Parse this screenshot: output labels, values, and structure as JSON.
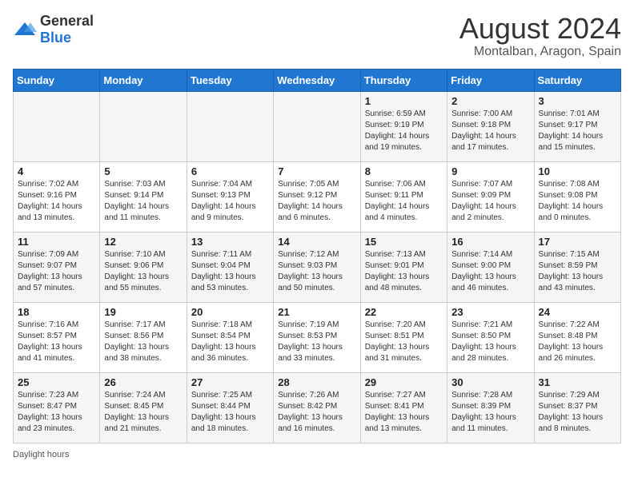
{
  "logo": {
    "text_general": "General",
    "text_blue": "Blue"
  },
  "title": "August 2024",
  "subtitle": "Montalban, Aragon, Spain",
  "days_of_week": [
    "Sunday",
    "Monday",
    "Tuesday",
    "Wednesday",
    "Thursday",
    "Friday",
    "Saturday"
  ],
  "weeks": [
    [
      {
        "day": "",
        "info": ""
      },
      {
        "day": "",
        "info": ""
      },
      {
        "day": "",
        "info": ""
      },
      {
        "day": "",
        "info": ""
      },
      {
        "day": "1",
        "info": "Sunrise: 6:59 AM\nSunset: 9:19 PM\nDaylight: 14 hours\nand 19 minutes."
      },
      {
        "day": "2",
        "info": "Sunrise: 7:00 AM\nSunset: 9:18 PM\nDaylight: 14 hours\nand 17 minutes."
      },
      {
        "day": "3",
        "info": "Sunrise: 7:01 AM\nSunset: 9:17 PM\nDaylight: 14 hours\nand 15 minutes."
      }
    ],
    [
      {
        "day": "4",
        "info": "Sunrise: 7:02 AM\nSunset: 9:16 PM\nDaylight: 14 hours\nand 13 minutes."
      },
      {
        "day": "5",
        "info": "Sunrise: 7:03 AM\nSunset: 9:14 PM\nDaylight: 14 hours\nand 11 minutes."
      },
      {
        "day": "6",
        "info": "Sunrise: 7:04 AM\nSunset: 9:13 PM\nDaylight: 14 hours\nand 9 minutes."
      },
      {
        "day": "7",
        "info": "Sunrise: 7:05 AM\nSunset: 9:12 PM\nDaylight: 14 hours\nand 6 minutes."
      },
      {
        "day": "8",
        "info": "Sunrise: 7:06 AM\nSunset: 9:11 PM\nDaylight: 14 hours\nand 4 minutes."
      },
      {
        "day": "9",
        "info": "Sunrise: 7:07 AM\nSunset: 9:09 PM\nDaylight: 14 hours\nand 2 minutes."
      },
      {
        "day": "10",
        "info": "Sunrise: 7:08 AM\nSunset: 9:08 PM\nDaylight: 14 hours\nand 0 minutes."
      }
    ],
    [
      {
        "day": "11",
        "info": "Sunrise: 7:09 AM\nSunset: 9:07 PM\nDaylight: 13 hours\nand 57 minutes."
      },
      {
        "day": "12",
        "info": "Sunrise: 7:10 AM\nSunset: 9:06 PM\nDaylight: 13 hours\nand 55 minutes."
      },
      {
        "day": "13",
        "info": "Sunrise: 7:11 AM\nSunset: 9:04 PM\nDaylight: 13 hours\nand 53 minutes."
      },
      {
        "day": "14",
        "info": "Sunrise: 7:12 AM\nSunset: 9:03 PM\nDaylight: 13 hours\nand 50 minutes."
      },
      {
        "day": "15",
        "info": "Sunrise: 7:13 AM\nSunset: 9:01 PM\nDaylight: 13 hours\nand 48 minutes."
      },
      {
        "day": "16",
        "info": "Sunrise: 7:14 AM\nSunset: 9:00 PM\nDaylight: 13 hours\nand 46 minutes."
      },
      {
        "day": "17",
        "info": "Sunrise: 7:15 AM\nSunset: 8:59 PM\nDaylight: 13 hours\nand 43 minutes."
      }
    ],
    [
      {
        "day": "18",
        "info": "Sunrise: 7:16 AM\nSunset: 8:57 PM\nDaylight: 13 hours\nand 41 minutes."
      },
      {
        "day": "19",
        "info": "Sunrise: 7:17 AM\nSunset: 8:56 PM\nDaylight: 13 hours\nand 38 minutes."
      },
      {
        "day": "20",
        "info": "Sunrise: 7:18 AM\nSunset: 8:54 PM\nDaylight: 13 hours\nand 36 minutes."
      },
      {
        "day": "21",
        "info": "Sunrise: 7:19 AM\nSunset: 8:53 PM\nDaylight: 13 hours\nand 33 minutes."
      },
      {
        "day": "22",
        "info": "Sunrise: 7:20 AM\nSunset: 8:51 PM\nDaylight: 13 hours\nand 31 minutes."
      },
      {
        "day": "23",
        "info": "Sunrise: 7:21 AM\nSunset: 8:50 PM\nDaylight: 13 hours\nand 28 minutes."
      },
      {
        "day": "24",
        "info": "Sunrise: 7:22 AM\nSunset: 8:48 PM\nDaylight: 13 hours\nand 26 minutes."
      }
    ],
    [
      {
        "day": "25",
        "info": "Sunrise: 7:23 AM\nSunset: 8:47 PM\nDaylight: 13 hours\nand 23 minutes."
      },
      {
        "day": "26",
        "info": "Sunrise: 7:24 AM\nSunset: 8:45 PM\nDaylight: 13 hours\nand 21 minutes."
      },
      {
        "day": "27",
        "info": "Sunrise: 7:25 AM\nSunset: 8:44 PM\nDaylight: 13 hours\nand 18 minutes."
      },
      {
        "day": "28",
        "info": "Sunrise: 7:26 AM\nSunset: 8:42 PM\nDaylight: 13 hours\nand 16 minutes."
      },
      {
        "day": "29",
        "info": "Sunrise: 7:27 AM\nSunset: 8:41 PM\nDaylight: 13 hours\nand 13 minutes."
      },
      {
        "day": "30",
        "info": "Sunrise: 7:28 AM\nSunset: 8:39 PM\nDaylight: 13 hours\nand 11 minutes."
      },
      {
        "day": "31",
        "info": "Sunrise: 7:29 AM\nSunset: 8:37 PM\nDaylight: 13 hours\nand 8 minutes."
      }
    ]
  ],
  "footer": "Daylight hours"
}
